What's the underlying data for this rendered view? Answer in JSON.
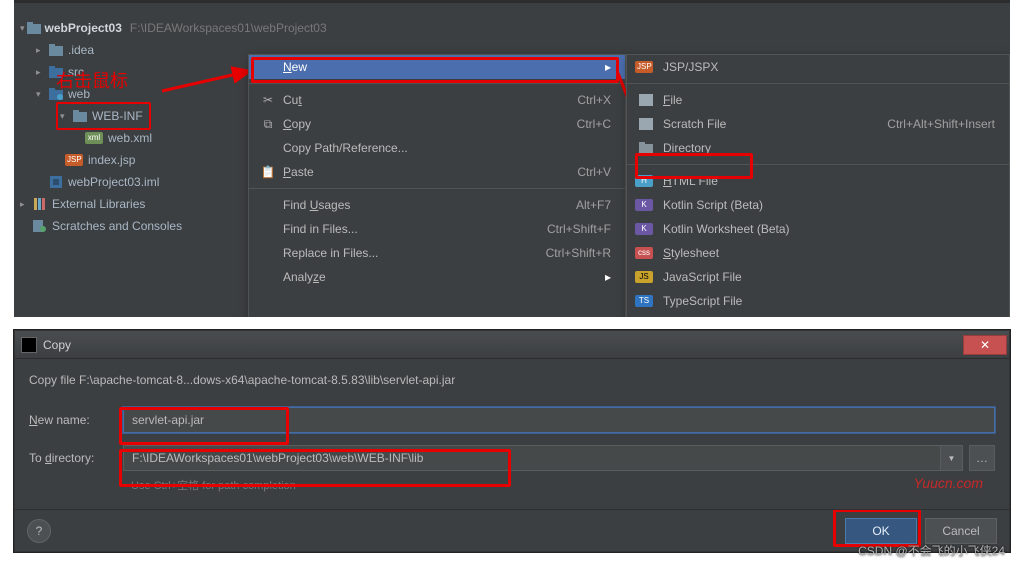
{
  "annotation": {
    "red_text": "右击鼠标"
  },
  "tree": {
    "project": {
      "name": "webProject03",
      "path": "F:\\IDEAWorkspaces01\\webProject03"
    },
    "idea": ".idea",
    "src": "src",
    "web": "web",
    "webinf": "WEB-INF",
    "webxml": "web.xml",
    "indexjsp": "index.jsp",
    "iml": "webProject03.iml",
    "extlib": "External Libraries",
    "scratches": "Scratches and Consoles"
  },
  "menu1": {
    "new": {
      "label": "New"
    },
    "cut": {
      "label": "Cut",
      "shortcut": "Ctrl+X"
    },
    "copy": {
      "label": "Copy",
      "shortcut": "Ctrl+C"
    },
    "copypath": {
      "label": "Copy Path/Reference..."
    },
    "paste": {
      "label": "Paste",
      "shortcut": "Ctrl+V"
    },
    "findusg": {
      "label": "Find Usages",
      "shortcut": "Alt+F7"
    },
    "findfiles": {
      "label": "Find in Files...",
      "shortcut": "Ctrl+Shift+F"
    },
    "replfiles": {
      "label": "Replace in Files...",
      "shortcut": "Ctrl+Shift+R"
    },
    "analyze": {
      "label": "Analyze"
    }
  },
  "menu2": {
    "jsp": {
      "label": "JSP/JSPX"
    },
    "file": {
      "label": "File"
    },
    "scratch": {
      "label": "Scratch File",
      "shortcut": "Ctrl+Alt+Shift+Insert"
    },
    "dir": {
      "label": "Directory"
    },
    "html": {
      "label": "HTML File"
    },
    "kts": {
      "label": "Kotlin Script (Beta)"
    },
    "ktws": {
      "label": "Kotlin Worksheet (Beta)"
    },
    "css": {
      "label": "Stylesheet"
    },
    "js": {
      "label": "JavaScript File"
    },
    "ts": {
      "label": "TypeScript File"
    }
  },
  "dialog": {
    "title": "Copy",
    "message": "Copy file F:\\apache-tomcat-8...dows-x64\\apache-tomcat-8.5.83\\lib\\servlet-api.jar",
    "newname_label": "New name:",
    "newname_value": "servlet-api.jar",
    "todir_label_pre": "To ",
    "todir_label_u": "d",
    "todir_label_post": "irectory:",
    "todir_value": "F:\\IDEAWorkspaces01\\webProject03\\web\\WEB-INF\\lib",
    "hint": "Use Ctrl+空格 for path completion",
    "ok": "OK",
    "cancel": "Cancel"
  },
  "watermarks": {
    "bottom": "CSDN @不会飞的小飞侠24",
    "yc": "Yuucn.com"
  }
}
